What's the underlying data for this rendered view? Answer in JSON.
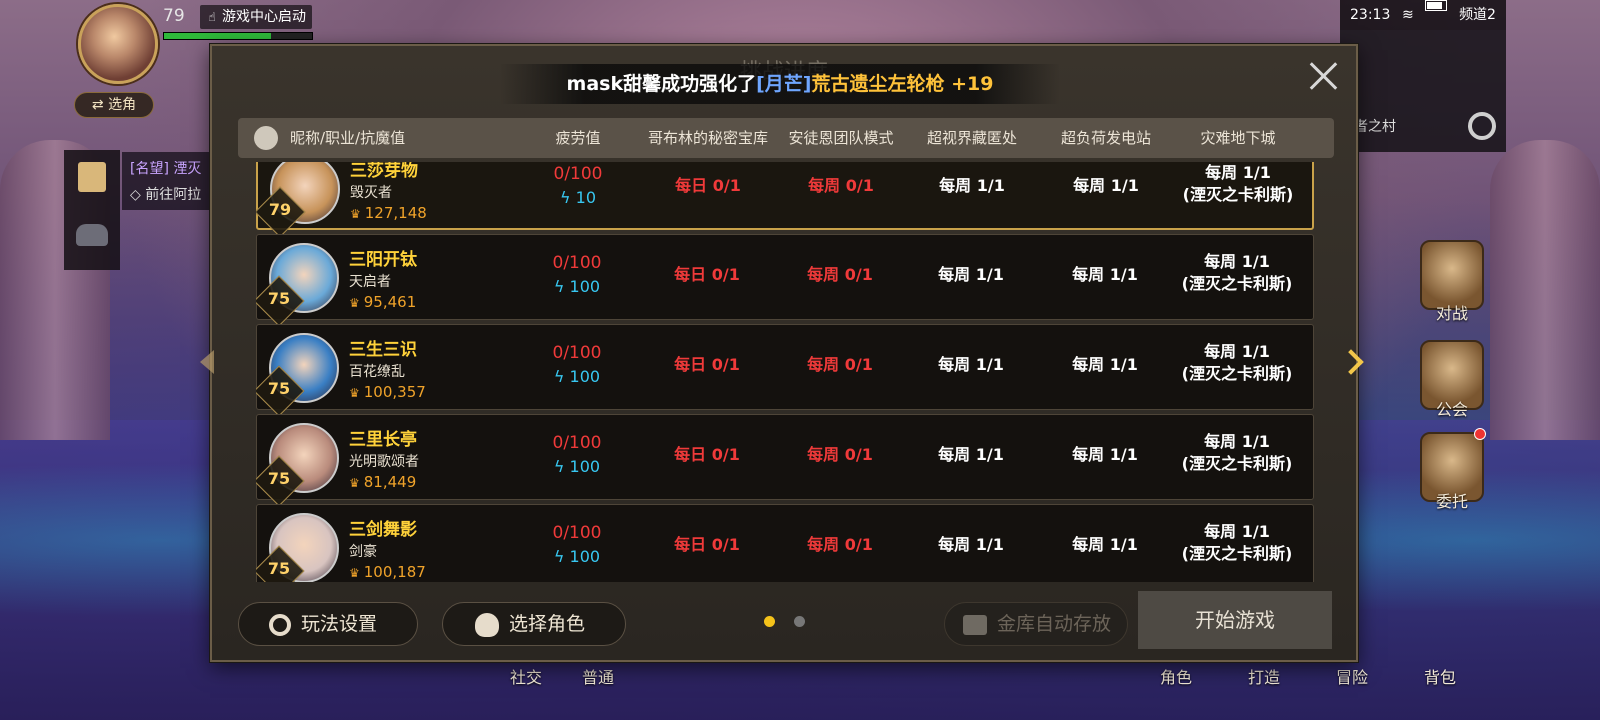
{
  "hud": {
    "level": "79",
    "game_center_label": "游戏中心启动",
    "hp_fraction": 0.72,
    "switch_role_label": "⇄ 选角",
    "quest_title": "[名望] 湮灭",
    "quest_subtitle": "前往阿拉"
  },
  "status": {
    "time": "23:13",
    "channel": "频道2",
    "village": "者之村"
  },
  "right_menu": {
    "battle": "对战",
    "guild": "公会",
    "commission": "委托"
  },
  "bottom_nav": {
    "social": "社交",
    "normal": "普通",
    "character": "角色",
    "craft": "打造",
    "adventure": "冒险",
    "bag": "背包"
  },
  "dialog": {
    "title": "挑战进度",
    "notice": {
      "player": "mask甜馨成功强化了",
      "item_tag": "[月芒]",
      "item_name": "荒古遗尘左轮枪",
      "bonus": " +19"
    },
    "headers": {
      "name": "昵称/职业/抗魔值",
      "fatigue": "疲劳值",
      "goblin": "哥布林的秘密宝库",
      "antoine": "安徒恩团队模式",
      "hidden": "超视界藏匿处",
      "power": "超负荷发电站",
      "disaster": "灾难地下城"
    },
    "rows": [
      {
        "name": "三莎芽物",
        "job": "毁灭者",
        "level": "79",
        "power": "127,148",
        "fatigue": "0/100",
        "fatigue_extra": "10",
        "goblin": "每日 0/1",
        "antoine": "每周 0/1",
        "hidden": "每周 1/1",
        "station": "每周 1/1",
        "disaster_a": "每周 1/1",
        "disaster_b": "(湮灭之卡利斯)"
      },
      {
        "name": "三阳开钛",
        "job": "天启者",
        "level": "75",
        "power": "95,461",
        "fatigue": "0/100",
        "fatigue_extra": "100",
        "goblin": "每日 0/1",
        "antoine": "每周 0/1",
        "hidden": "每周 1/1",
        "station": "每周 1/1",
        "disaster_a": "每周 1/1",
        "disaster_b": "(湮灭之卡利斯)"
      },
      {
        "name": "三生三识",
        "job": "百花缭乱",
        "level": "75",
        "power": "100,357",
        "fatigue": "0/100",
        "fatigue_extra": "100",
        "goblin": "每日 0/1",
        "antoine": "每周 0/1",
        "hidden": "每周 1/1",
        "station": "每周 1/1",
        "disaster_a": "每周 1/1",
        "disaster_b": "(湮灭之卡利斯)"
      },
      {
        "name": "三里长亭",
        "job": "光明歌颂者",
        "level": "75",
        "power": "81,449",
        "fatigue": "0/100",
        "fatigue_extra": "100",
        "goblin": "每日 0/1",
        "antoine": "每周 0/1",
        "hidden": "每周 1/1",
        "station": "每周 1/1",
        "disaster_a": "每周 1/1",
        "disaster_b": "(湮灭之卡利斯)"
      },
      {
        "name": "三剑舞影",
        "job": "剑豪",
        "level": "75",
        "power": "100,187",
        "fatigue": "0/100",
        "fatigue_extra": "100",
        "goblin": "每日 0/1",
        "antoine": "每周 0/1",
        "hidden": "每周 1/1",
        "station": "每周 1/1",
        "disaster_a": "每周 1/1",
        "disaster_b": "(湮灭之卡利斯)"
      }
    ],
    "buttons": {
      "settings": "玩法设置",
      "select_char": "选择角色",
      "vault": "金库自动存放",
      "start": "开始游戏"
    },
    "page": {
      "current": 1,
      "total": 2
    }
  },
  "colors": {
    "accent_gold": "#ffd23a",
    "red_value": "#f03a3a",
    "cyan_value": "#38c7f0",
    "item_blue": "#6fa6ff"
  }
}
